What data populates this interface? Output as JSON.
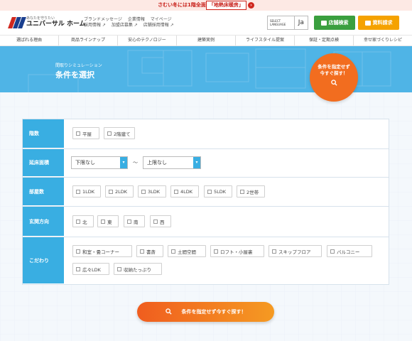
{
  "topbar": {
    "pre": "さむい冬には1階全面",
    "highlight": "「地熱床暖房」",
    "arrow": "›"
  },
  "header": {
    "logo_tagline": "あなたを守りたい",
    "logo_name": "ユニバーサル ホーム",
    "links_row1": [
      "ブランドメッセージ",
      "企業情報",
      "マイページ"
    ],
    "links_row2": [
      "採用情報 ↗",
      "加盟店募集 ↗",
      "店舗採用情報 ↗"
    ],
    "lang_label": "SELECT LANGUAGE",
    "lang_value": "Ja",
    "store_button": "店舗検索",
    "doc_button": "資料請求",
    "brand_colors": {
      "green": "#3a9f3f",
      "orange": "#f5a200"
    }
  },
  "gnav": [
    "選ばれる理由",
    "商品ラインナップ",
    "安心のテクノロジー",
    "建築実例",
    "ライフスタイル提案",
    "保証・定期点検",
    "幸せ家づくりレシピ"
  ],
  "hero": {
    "subtitle": "間取りシミュレーション",
    "title": "条件を選択"
  },
  "circle": {
    "line1": "条件を指定せず",
    "line2": "今すぐ探す！",
    "icon": "search-icon"
  },
  "form": {
    "floors": {
      "label": "階数",
      "options": [
        "平屋",
        "2階建て"
      ]
    },
    "area": {
      "label": "延床面積",
      "min": "下限なし",
      "max": "上限なし",
      "tilde": "〜"
    },
    "rooms": {
      "label": "部屋数",
      "options": [
        "1LDK",
        "2LDK",
        "3LDK",
        "4LDK",
        "5LDK",
        "2世帯"
      ]
    },
    "entrance": {
      "label": "玄関方向",
      "options": [
        "北",
        "東",
        "南",
        "西"
      ]
    },
    "features": {
      "label": "こだわり",
      "options": [
        "和室・畳コーナー",
        "書斎",
        "土間空間",
        "ロフト・小屋裏",
        "スキップフロア",
        "バルコニー",
        "広々LDK",
        "収納たっぷり"
      ]
    }
  },
  "submit": {
    "label": "条件を指定せず今すぐ探す！",
    "icon": "search-icon"
  },
  "accent_color": "#39aee2"
}
